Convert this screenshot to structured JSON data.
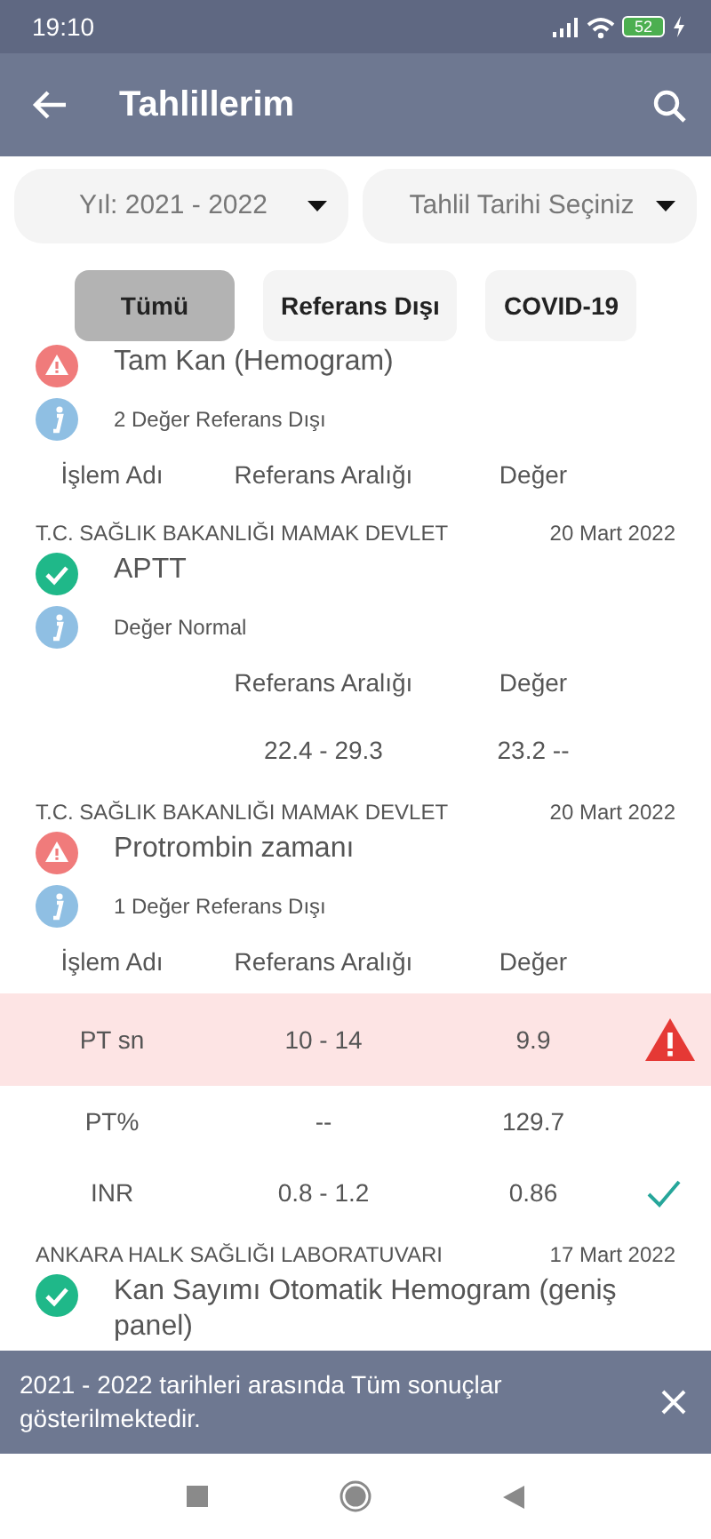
{
  "status_bar": {
    "time": "19:10",
    "battery": "52"
  },
  "app_bar": {
    "title": "Tahlillerim"
  },
  "filters": [
    {
      "value": "Yıl: 2021 - 2022"
    },
    {
      "value": "Tahlil Tarihi Seçiniz"
    }
  ],
  "chips": [
    {
      "label": "Tümü",
      "selected": true
    },
    {
      "label": "Referans Dışı",
      "selected": false
    },
    {
      "label": "COVID-19",
      "selected": false
    }
  ],
  "results": [
    {
      "out_of_range": true,
      "name": "Tam Kan (Hemogram)",
      "info": "2 Değer Referans Dışı",
      "columns": [
        "İşlem Adı",
        "Referans Aralığı",
        "Değer"
      ]
    },
    {
      "lab": "T.C. SAĞLIK BAKANLIĞI MAMAK DEVLET",
      "date": "20 Mart 2022",
      "out_of_range": false,
      "name": "APTT",
      "info": "Değer Normal",
      "columns": [
        "",
        "Referans Aralığı",
        "Değer"
      ],
      "rows": [
        {
          "cells": [
            "",
            "22.4 - 29.3",
            "23.2 --"
          ],
          "out_of_range": false,
          "checked": false
        }
      ]
    },
    {
      "lab": "T.C. SAĞLIK BAKANLIĞI MAMAK DEVLET",
      "date": "20 Mart 2022",
      "out_of_range": true,
      "name": "Protrombin zamanı",
      "info": "1 Değer Referans Dışı",
      "columns": [
        "İşlem Adı",
        "Referans Aralığı",
        "Değer"
      ],
      "rows": [
        {
          "cells": [
            "PT sn",
            "10 - 14",
            "9.9"
          ],
          "out_of_range": true,
          "checked": false
        },
        {
          "cells": [
            "PT%",
            "--",
            "129.7"
          ],
          "out_of_range": false,
          "checked": false
        },
        {
          "cells": [
            "INR",
            "0.8 - 1.2",
            "0.86"
          ],
          "out_of_range": false,
          "checked": true
        }
      ]
    },
    {
      "lab": "ANKARA HALK SAĞLIĞI LABORATUVARI",
      "date": "17 Mart 2022",
      "out_of_range": false,
      "name": "Kan Sayımı Otomatik Hemogram (geniş panel)"
    }
  ],
  "snackbar": {
    "message": "2021 - 2022 tarihleri arasında Tüm sonuçlar gösterilmektedir."
  }
}
